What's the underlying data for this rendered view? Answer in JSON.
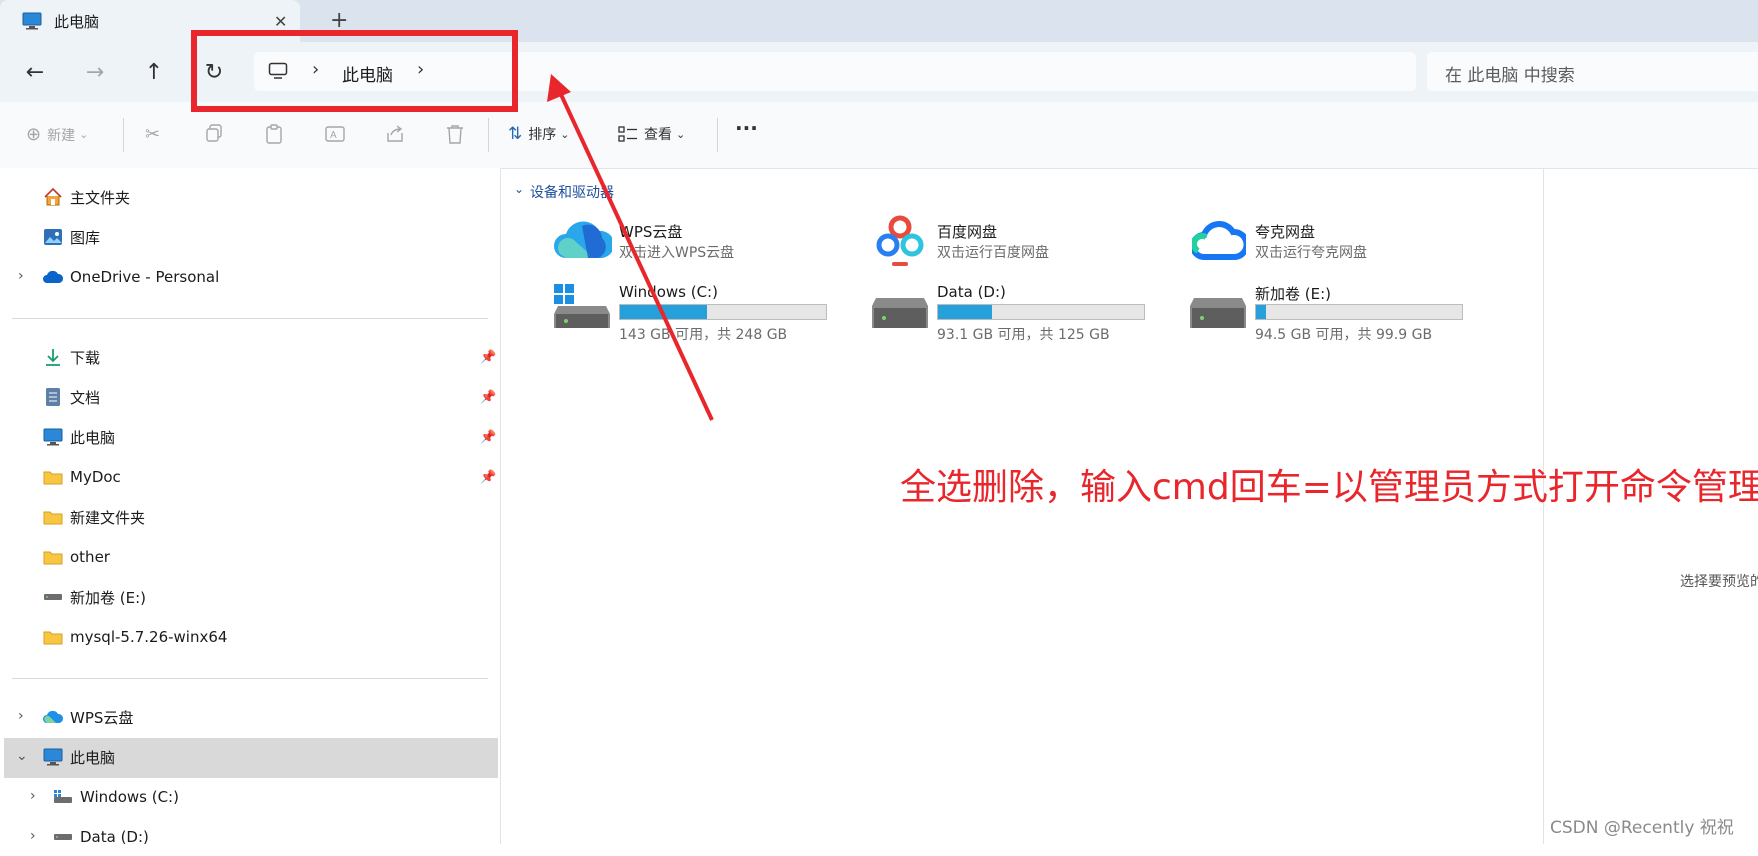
{
  "window": {
    "tab_title": "此电脑",
    "tab_close": "✕",
    "new_tab": "+"
  },
  "nav": {
    "back": "←",
    "forward": "→",
    "up": "↑",
    "refresh": "↻",
    "breadcrumb": [
      "此电脑"
    ],
    "search_placeholder": "在 此电脑 中搜索"
  },
  "toolbar": {
    "new_label": "新建",
    "sort_label": "排序",
    "view_label": "查看",
    "more_label": "···"
  },
  "sidebar": {
    "quick": [
      {
        "label": "主文件夹",
        "icon": "home-icon"
      },
      {
        "label": "图库",
        "icon": "gallery-icon"
      },
      {
        "label": "OneDrive - Personal",
        "icon": "onedrive-icon"
      }
    ],
    "pinned": [
      {
        "label": "下载",
        "icon": "download-icon"
      },
      {
        "label": "文档",
        "icon": "document-icon"
      },
      {
        "label": "此电脑",
        "icon": "pc-icon"
      },
      {
        "label": "MyDoc",
        "icon": "folder-icon"
      },
      {
        "label": "新建文件夹",
        "icon": "folder-icon"
      },
      {
        "label": "other",
        "icon": "folder-icon"
      },
      {
        "label": "新加卷 (E:)",
        "icon": "drive-icon"
      },
      {
        "label": "mysql-5.7.26-winx64",
        "icon": "folder-icon"
      }
    ],
    "tree": [
      {
        "label": "WPS云盘",
        "icon": "wps-cloud-icon"
      },
      {
        "label": "此电脑",
        "icon": "pc-icon"
      },
      {
        "label": "Windows (C:)",
        "icon": "windows-drive-icon"
      },
      {
        "label": "Data (D:)",
        "icon": "drive-icon"
      }
    ]
  },
  "main": {
    "section_label": "设备和驱动器",
    "apps": [
      {
        "name": "WPS云盘",
        "desc": "双击进入WPS云盘",
        "icon": "wps-cloud-icon"
      },
      {
        "name": "百度网盘",
        "desc": "双击运行百度网盘",
        "icon": "baidu-netdisk-icon"
      },
      {
        "name": "夸克网盘",
        "desc": "双击运行夸克网盘",
        "icon": "quark-netdisk-icon"
      }
    ],
    "drives": [
      {
        "name": "Windows (C:)",
        "capacity": "143 GB 可用，共 248 GB",
        "used_fraction": 0.42
      },
      {
        "name": "Data (D:)",
        "capacity": "93.1 GB 可用，共 125 GB",
        "used_fraction": 0.26
      },
      {
        "name": "新加卷 (E:)",
        "capacity": "94.5 GB 可用，共 99.9 GB",
        "used_fraction": 0.05
      }
    ],
    "preview_hint": "选择要预览的"
  },
  "annotation": {
    "text": "全选删除，输入cmd回车=以管理员方式打开命令管理行",
    "color": "#e8262c"
  },
  "watermark": "CSDN @Recently 祝祝",
  "colors": {
    "accent": "#26a0da",
    "annotation_red": "#e8262c"
  }
}
